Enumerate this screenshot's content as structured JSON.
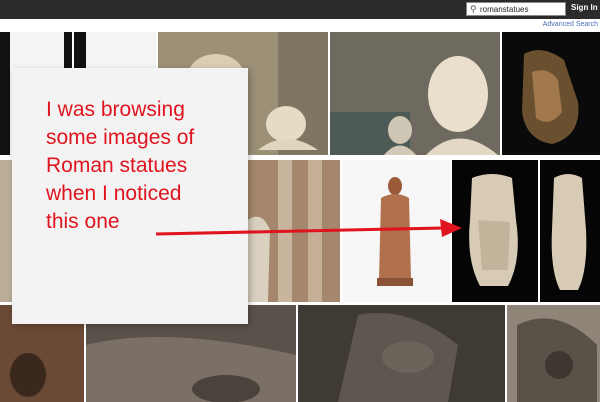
{
  "header": {
    "search_value": "romanstatues",
    "search_icon": "search-icon",
    "signin_label": "Sign In",
    "advanced_search_label": "Advanced Search"
  },
  "annotation": {
    "text": "I was browsing\nsome images  of\nRoman statues\nwhen I noticed\nthis one",
    "color": "#e0141e"
  },
  "colors": {
    "topbar": "#2b2b2b",
    "link": "#4a6fb5",
    "arrow": "#e0141e"
  }
}
